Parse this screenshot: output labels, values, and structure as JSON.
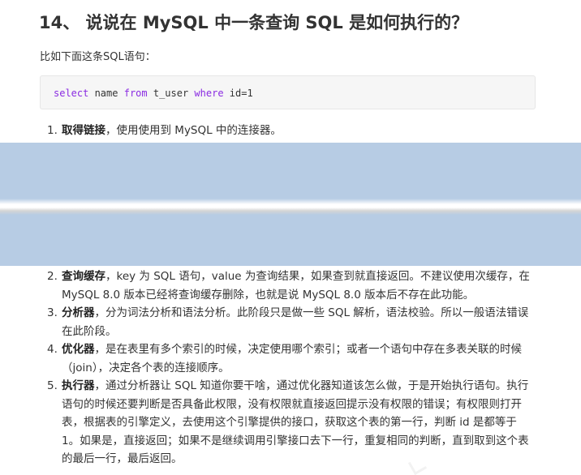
{
  "heading": "14、 说说在 MySQL 中一条查询 SQL 是如何执行的？",
  "intro": "比如下面这条SQL语句：",
  "code": {
    "t1": "select",
    "t2": " name ",
    "t3": "from",
    "t4": " t_user ",
    "t5": "where",
    "t6": " id=1"
  },
  "list_first": [
    {
      "num": "1.",
      "title": "取得链接",
      "body": "，使用使用到 MySQL 中的连接器。"
    }
  ],
  "list_rest": [
    {
      "num": "2.",
      "title": "查询缓存",
      "body": "，key 为 SQL 语句，value 为查询结果，如果查到就直接返回。不建议使用次缓存，在 MySQL 8.0 版本已经将查询缓存删除，也就是说 MySQL 8.0 版本后不存在此功能。"
    },
    {
      "num": "3.",
      "title": "分析器",
      "body": "，分为词法分析和语法分析。此阶段只是做一些 SQL 解析，语法校验。所以一般语法错误在此阶段。"
    },
    {
      "num": "4.",
      "title": "优化器",
      "body": "，是在表里有多个索引的时候，决定使用哪个索引；或者一个语句中存在多表关联的时候（join），决定各个表的连接顺序。"
    },
    {
      "num": "5.",
      "title": "执行器",
      "body": "，通过分析器让 SQL 知道你要干啥，通过优化器知道该怎么做，于是开始执行语句。执行语句的时候还要判断是否具备此权限，没有权限就直接返回提示没有权限的错误；有权限则打开表，根据表的引擎定义，去使用这个引擎提供的接口，获取这个表的第一行，判断 id 是都等于 1。如果是，直接返回；如果不是继续调用引擎接口去下一行，重复相同的判断，直到取到这个表的最后一行，最后返回。"
    }
  ]
}
